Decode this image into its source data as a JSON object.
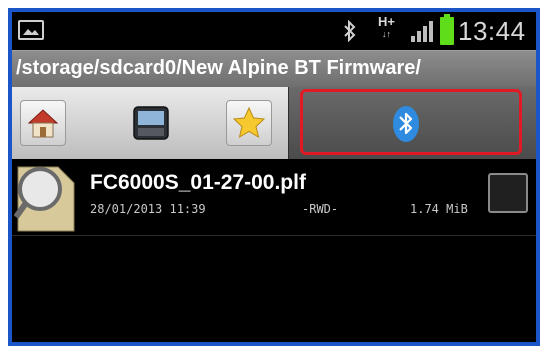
{
  "status_bar": {
    "clock": "13:44",
    "network": "H+",
    "network_arrows": "↓↑",
    "battery_color": "#5fdc1a",
    "icons": [
      "gallery-icon",
      "bluetooth-icon",
      "signal-icon",
      "battery-icon"
    ]
  },
  "path_bar": {
    "path": "/storage/sdcard0/New Alpine BT Firmware/"
  },
  "toolbar": {
    "buttons": [
      "home-icon",
      "device-icon",
      "star-icon"
    ],
    "bluetooth_button": "bluetooth-icon",
    "highlight_color": "#e01a25",
    "bluetooth_color": "#2e8be0"
  },
  "files": [
    {
      "name": "FC6000S_01-27-00.plf",
      "date": "28/01/2013 11:39",
      "permissions": "-RWD-",
      "size": "1.74 MiB",
      "icon": "file-search-icon",
      "checked": false
    }
  ],
  "frame_color": "#1a56c8"
}
